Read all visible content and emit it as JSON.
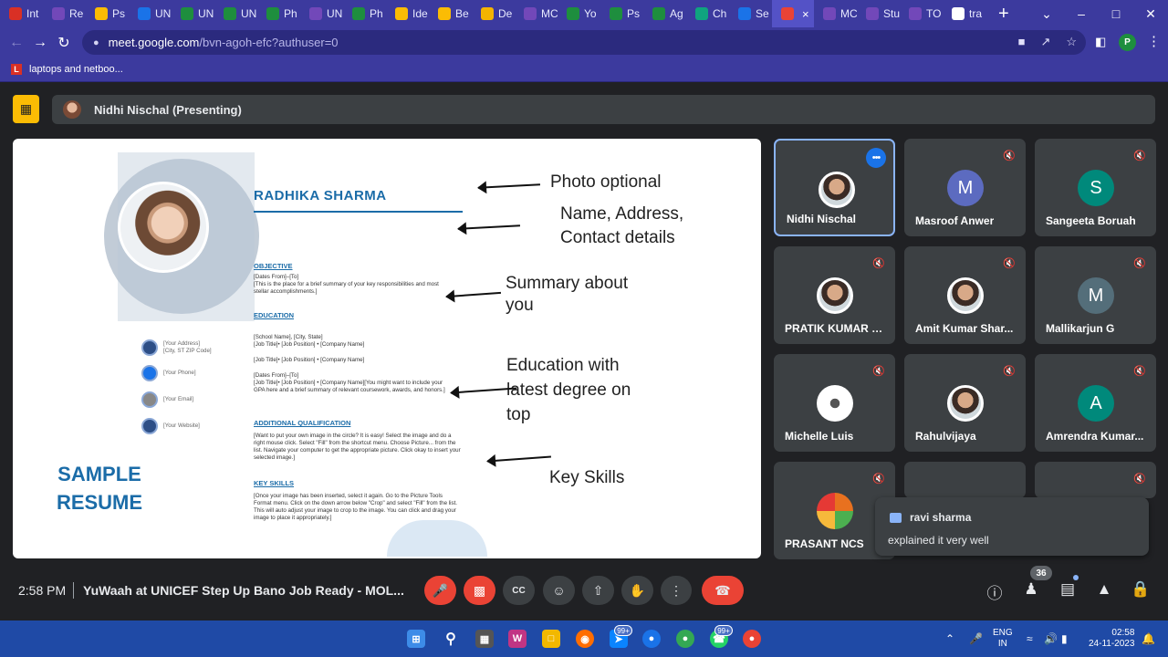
{
  "browser": {
    "tabs": [
      {
        "label": "Int",
        "icon": "gmail-icon",
        "color": "#d93025"
      },
      {
        "label": "Re",
        "icon": "forms-icon",
        "color": "#7248b9"
      },
      {
        "label": "Ps",
        "icon": "drive-icon",
        "color": "#fbbc04"
      },
      {
        "label": "UN",
        "icon": "c-icon",
        "color": "#1a73e8"
      },
      {
        "label": "UN",
        "icon": "sheets-icon",
        "color": "#1e8e3e"
      },
      {
        "label": "UN",
        "icon": "sheets-icon",
        "color": "#1e8e3e"
      },
      {
        "label": "Ph",
        "icon": "sheets-icon",
        "color": "#1e8e3e"
      },
      {
        "label": "UN",
        "icon": "video-icon",
        "color": "#7248b9"
      },
      {
        "label": "Ph",
        "icon": "sheets-icon",
        "color": "#1e8e3e"
      },
      {
        "label": "Ide",
        "icon": "drive-icon",
        "color": "#fbbc04"
      },
      {
        "label": "Be",
        "icon": "drive-icon",
        "color": "#fbbc04"
      },
      {
        "label": "De",
        "icon": "slides-icon",
        "color": "#f4b400"
      },
      {
        "label": "MC",
        "icon": "forms-icon",
        "color": "#7248b9"
      },
      {
        "label": "Yo",
        "icon": "check-icon",
        "color": "#1e8e3e"
      },
      {
        "label": "Ps",
        "icon": "sheets-icon",
        "color": "#1e8e3e"
      },
      {
        "label": "Ag",
        "icon": "sheets-icon",
        "color": "#1e8e3e"
      },
      {
        "label": "Ch",
        "icon": "chatgpt-icon",
        "color": "#10a37f"
      },
      {
        "label": "Se",
        "icon": "calendar-icon",
        "color": "#1a73e8"
      },
      {
        "label": "",
        "icon": "meet-icon",
        "color": "#ea4335",
        "active": true
      },
      {
        "label": "MC",
        "icon": "forms-icon",
        "color": "#7248b9"
      },
      {
        "label": "Stu",
        "icon": "forms-icon",
        "color": "#7248b9"
      },
      {
        "label": "TO",
        "icon": "forms-icon",
        "color": "#7248b9"
      },
      {
        "label": "tra",
        "icon": "google-icon",
        "color": "#ffffff"
      }
    ],
    "url_host": "meet.google.com",
    "url_path": "/bvn-agoh-efc?authuser=0",
    "profile_initial": "P",
    "bookmark_label": "laptops and netboo...",
    "bookmark_icon_letter": "L"
  },
  "presenting": {
    "label": "Nidhi Nischal (Presenting)"
  },
  "slide": {
    "name": "RADHIKA SHARMA",
    "objective_h": "OBJECTIVE",
    "objective_t": "[Dates From]–[To]\n[This is the place for a brief summary of your key responsibilities and most stellar accomplishments.]",
    "education_h": "EDUCATION",
    "education_t1": "[School Name], [City, State]\n[Job Title]• [Job Position] • [Company Name]",
    "education_t2": "[Job Title]• [Job Position] • [Company Name]",
    "education_t3": "[Dates From]–[To]\n[Job Title]• [Job Position] • [Company Name][You might want to include your GPA here and a brief summary of relevant coursework, awards, and honors.]",
    "addl_h": "ADDITIONAL QUALIFICATION",
    "addl_t": "[Want to put your own image in the circle?  It is easy!  Select the image and do a right mouse click.  Select \"Fill\" from the shortcut menu.  Choose Picture... from the list.  Navigate your computer to get the appropriate picture.  Click okay to insert your selected image.]",
    "skills_h": "KEY SKILLS",
    "skills_t": "[Once your image has been inserted, select it again.  Go to the Picture Tools Format menu. Click on the down arrow below \"Crop\" and select \"Fill\" from the list.  This will auto adjust your image to crop to the image.  You can click and drag your image to place it appropriately.]",
    "address": "[Your Address]\n[City, ST ZIP Code]",
    "phone": "[Your Phone]",
    "email": "[Your Email]",
    "website": "[Your Website]",
    "sample_label": "SAMPLE RESUME",
    "annotations": {
      "photo": "Photo optional",
      "name": "Name, Address,\n Contact details",
      "summary": "Summary about\nyou",
      "education": "Education with\n   latest degree on\n   top",
      "skills": "Key Skills"
    }
  },
  "participants": [
    {
      "name": "Nidhi Nischal",
      "avatar": "photo",
      "initial": "",
      "color": "",
      "active": true
    },
    {
      "name": "Masroof Anwer",
      "avatar": "letter",
      "initial": "M",
      "color": "#5c6bc0"
    },
    {
      "name": "Sangeeta Boruah",
      "avatar": "letter",
      "initial": "S",
      "color": "#00897b"
    },
    {
      "name": "PRATIK KUMAR SI...",
      "avatar": "photo",
      "initial": "",
      "color": ""
    },
    {
      "name": "Amit Kumar Shar...",
      "avatar": "photo",
      "initial": "",
      "color": ""
    },
    {
      "name": "Mallikarjun G",
      "avatar": "letter",
      "initial": "M",
      "color": "#546e7a"
    },
    {
      "name": "Michelle Luis",
      "avatar": "emblem",
      "initial": "",
      "color": ""
    },
    {
      "name": "Rahulvijaya",
      "avatar": "photo",
      "initial": "",
      "color": ""
    },
    {
      "name": "Amrendra Kumar...",
      "avatar": "letter",
      "initial": "A",
      "color": "#00897b"
    },
    {
      "name": "PRASANT NCS",
      "avatar": "logo",
      "initial": "",
      "color": ""
    }
  ],
  "chat_popup": {
    "sender": "ravi sharma",
    "message": "explained it very well"
  },
  "bottom_bar": {
    "time": "2:58 PM",
    "meeting_title": "YuWaah at UNICEF Step Up Bano Job Ready - MOL...",
    "people_count": "36"
  },
  "taskbar": {
    "lang": "ENG",
    "region": "IN",
    "time": "02:58",
    "date": "24-11-2023",
    "badge_count": "99+"
  }
}
